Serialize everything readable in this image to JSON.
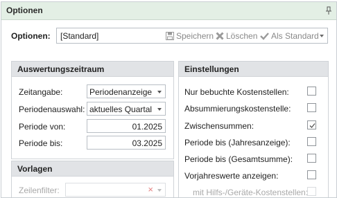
{
  "panel": {
    "title": "Optionen"
  },
  "options": {
    "label": "Optionen:",
    "value": "[Standard]",
    "save_label": "Speichern",
    "delete_label": "Löschen",
    "default_label": "Als Standard"
  },
  "zeitraum": {
    "title": "Auswertungszeitraum",
    "zeitangabe_label": "Zeitangabe:",
    "zeitangabe_value": "Periodenanzeige",
    "periodenauswahl_label": "Periodenauswahl:",
    "periodenauswahl_value": "aktuelles Quartal",
    "periode_von_label": "Periode von:",
    "periode_von_value": "01.2025",
    "periode_bis_label": "Periode bis:",
    "periode_bis_value": "03.2025"
  },
  "vorlagen": {
    "title": "Vorlagen",
    "zeilenfilter_label": "Zeilenfilter:"
  },
  "einstellungen": {
    "title": "Einstellungen",
    "items": [
      {
        "label": "Nur bebuchte Kostenstellen:",
        "checked": false
      },
      {
        "label": "Absummierungskostenstelle:",
        "checked": false
      },
      {
        "label": "Zwischensummen:",
        "checked": true
      },
      {
        "label": "Periode bis (Jahresanzeige):",
        "checked": false
      },
      {
        "label": "Periode bis (Gesamtsumme):",
        "checked": false
      },
      {
        "label": "Vorjahreswerte anzeigen:",
        "checked": false
      },
      {
        "label": "mit Hilfs-/Geräte-Kostenstellen:",
        "checked": false
      }
    ]
  }
}
